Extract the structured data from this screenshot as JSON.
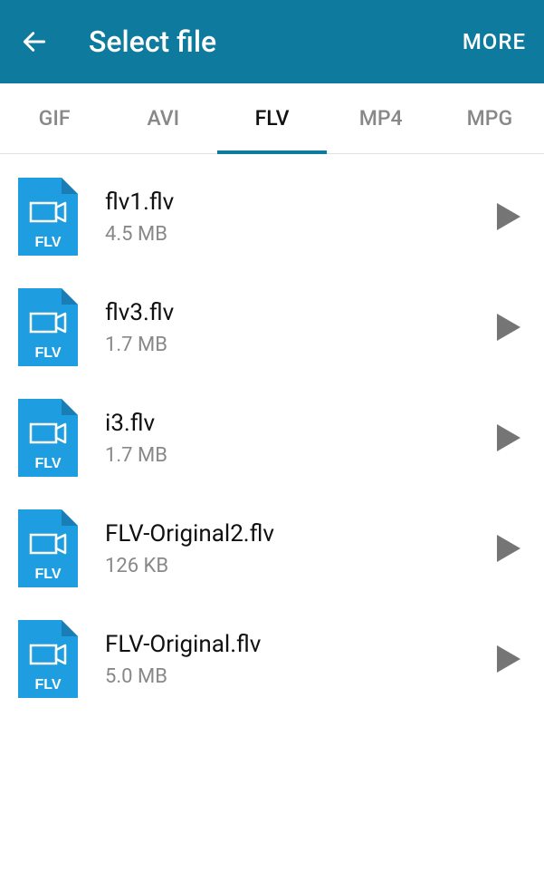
{
  "colors": {
    "header_bg": "#0d7a9e",
    "file_icon_bg": "#1e9ee0",
    "file_icon_fold": "#1a7db5",
    "tab_inactive": "#888888",
    "tab_active": "#111111",
    "play_icon": "#757575"
  },
  "header": {
    "title": "Select file",
    "more_label": "MORE"
  },
  "tabs": [
    {
      "label": "GIF",
      "active": false
    },
    {
      "label": "AVI",
      "active": false
    },
    {
      "label": "FLV",
      "active": true
    },
    {
      "label": "MP4",
      "active": false
    },
    {
      "label": "MPG",
      "active": false
    }
  ],
  "files": [
    {
      "name": "flv1.flv",
      "size": "4.5 MB",
      "ext": "FLV"
    },
    {
      "name": "flv3.flv",
      "size": "1.7 MB",
      "ext": "FLV"
    },
    {
      "name": "i3.flv",
      "size": "1.7 MB",
      "ext": "FLV"
    },
    {
      "name": "FLV-Original2.flv",
      "size": "126 KB",
      "ext": "FLV"
    },
    {
      "name": "FLV-Original.flv",
      "size": "5.0 MB",
      "ext": "FLV"
    }
  ]
}
